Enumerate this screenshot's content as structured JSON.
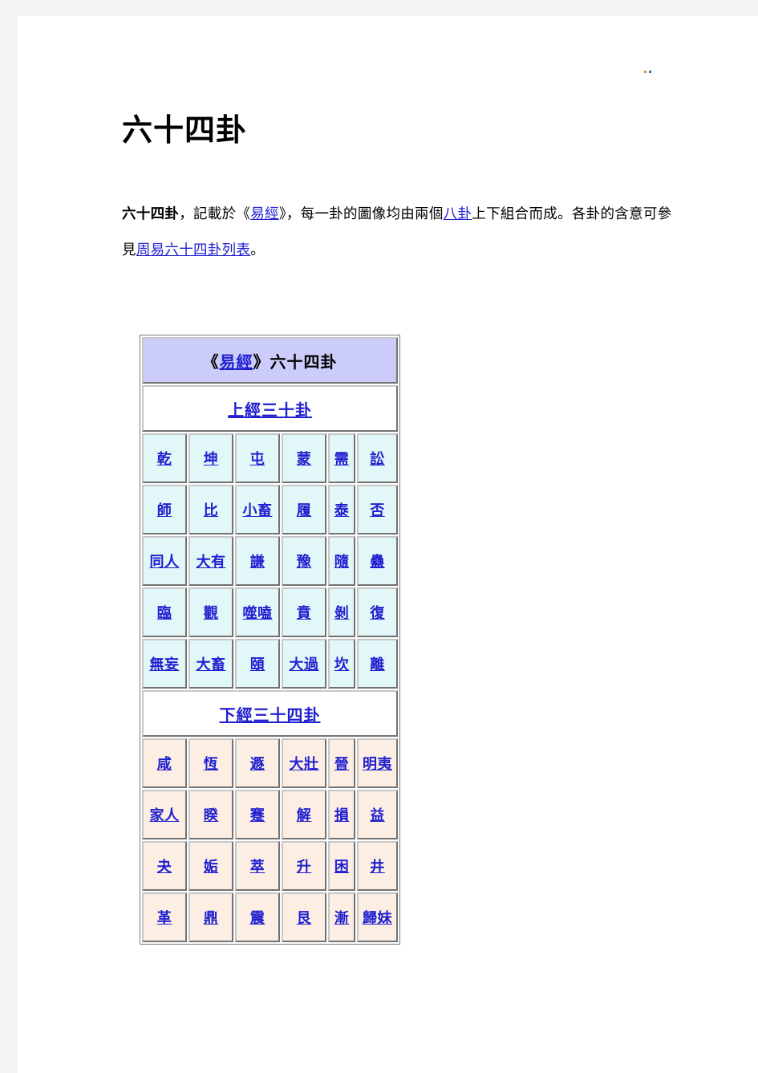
{
  "page": {
    "title": "六十四卦",
    "corner_mark": "decorative-dot-artifact"
  },
  "intro": {
    "bold_lead": "六十四卦",
    "seg1": "，記載於《",
    "link1": "易經",
    "seg2": "》，每一卦的圖像均由兩個",
    "link2": "八卦",
    "seg3": "上下組合而成。各卦的含意可參見",
    "link3": "周易六十四卦列表",
    "seg4": "。"
  },
  "table": {
    "caption_prefix": "《",
    "caption_link": "易經",
    "caption_suffix": "》六十四卦",
    "sections": [
      {
        "heading": "上經三十卦",
        "style": "upper",
        "rows": [
          [
            "乾",
            "坤",
            "屯",
            "蒙",
            "需",
            "訟"
          ],
          [
            "師",
            "比",
            "小畜",
            "履",
            "泰",
            "否"
          ],
          [
            "同人",
            "大有",
            "謙",
            "豫",
            "隨",
            "蠱"
          ],
          [
            "臨",
            "觀",
            "噬嗑",
            "賁",
            "剝",
            "復"
          ],
          [
            "無妄",
            "大畜",
            "頤",
            "大過",
            "坎",
            "離"
          ]
        ]
      },
      {
        "heading": "下經三十四卦",
        "style": "lower",
        "rows": [
          [
            "咸",
            "恆",
            "遯",
            "大壯",
            "晉",
            "明夷"
          ],
          [
            "家人",
            "睽",
            "蹇",
            "解",
            "損",
            "益"
          ],
          [
            "夬",
            "姤",
            "萃",
            "升",
            "困",
            "井"
          ],
          [
            "革",
            "鼎",
            "震",
            "艮",
            "漸",
            "歸妹"
          ]
        ]
      }
    ]
  },
  "colors": {
    "caption_bg": "#ccccfa",
    "upper_cell_bg": "#e2f8f8",
    "lower_cell_bg": "#fdeee4",
    "link": "#2020d0",
    "page_bg": "#ffffff",
    "gutter": "#f3f3f3"
  }
}
